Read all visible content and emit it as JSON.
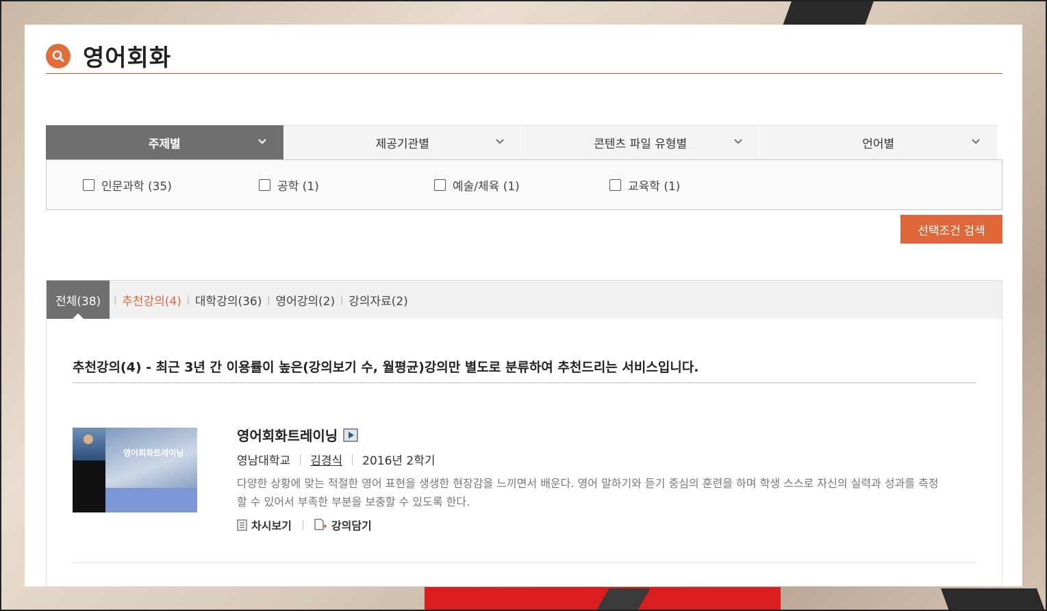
{
  "page": {
    "title": "영어회화"
  },
  "filters": {
    "tabs": [
      "주제별",
      "제공기관별",
      "콘텐츠 파일 유형별",
      "언어별"
    ],
    "active_index": 0,
    "options": [
      "인문과학 (35)",
      "공학 (1)",
      "예술/체육 (1)",
      "교육학 (1)"
    ],
    "search_button": "선택조건 검색"
  },
  "results": {
    "tabs": [
      "전체(38)",
      "추천강의(4)",
      "대학강의(36)",
      "영어강의(2)",
      "강의자료(2)"
    ],
    "notice": "추천강의(4) - 최근 3년 간 이용률이 높은(강의보기 수, 월평균)강의만 별도로 분류하여 추천드리는 서비스입니다.",
    "course": {
      "thumb_text": "영어회화트레이닝",
      "title": "영어회화트레이닝",
      "university": "영남대학교",
      "professor": "김경식",
      "term": "2016년 2학기",
      "description": "다양한 상황에 맞는 적절한 영어 표현을 생생한 현장감을 느끼면서 배운다. 영어 말하기와 듣기 중심의 훈련을 하며 학생 스스로 자신의 실력과 성과를 측정할 수 있어서 부족한 부분을 보충할 수 있도록 한다.",
      "action_view": "차시보기",
      "action_save": "강의담기"
    }
  },
  "colors": {
    "accent": "#e0673a",
    "active_tab": "#6f6f6f"
  }
}
